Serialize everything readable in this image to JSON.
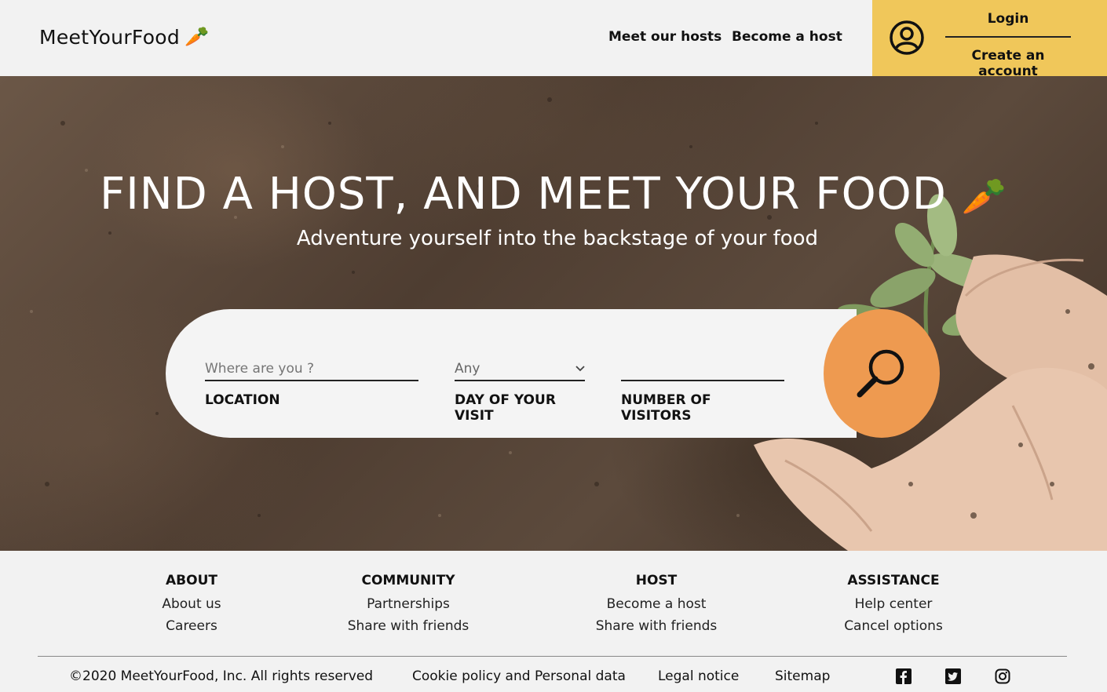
{
  "header": {
    "logo_text": "MeetYourFood",
    "logo_emoji": "🥕",
    "nav": [
      {
        "label": "Meet our hosts"
      },
      {
        "label": "Become a host"
      }
    ],
    "account": {
      "icon": "user-circle-icon",
      "login_label": "Login",
      "create_label": "Create an account",
      "bg_color": "#f0c75a"
    }
  },
  "hero": {
    "title": "FIND A HOST, AND MEET YOUR FOOD",
    "title_emoji": "🥕",
    "subtitle": "Adventure yourself into the backstage of your food",
    "search": {
      "location": {
        "placeholder": "Where are you ?",
        "label": "LOCATION"
      },
      "day": {
        "value": "Any",
        "label": "DAY OF YOUR VISIT"
      },
      "visitors": {
        "value": "",
        "label": "NUMBER OF VISITORS"
      },
      "button_icon": "search-icon",
      "button_color": "#ee9a50"
    }
  },
  "footer": {
    "columns": [
      {
        "heading": "ABOUT",
        "items": [
          "About us",
          "Careers"
        ]
      },
      {
        "heading": "COMMUNITY",
        "items": [
          "Partnerships",
          "Share with friends"
        ]
      },
      {
        "heading": "HOST",
        "items": [
          "Become a host",
          "Share with friends"
        ]
      },
      {
        "heading": "ASSISTANCE",
        "items": [
          "Help center",
          "Cancel options"
        ]
      }
    ],
    "copyright": "©2020 MeetYourFood, Inc. All rights reserved",
    "links": [
      "Cookie policy and Personal data",
      "Legal notice",
      "Sitemap"
    ],
    "social_icons": [
      "facebook-icon",
      "twitter-icon",
      "instagram-icon"
    ]
  }
}
